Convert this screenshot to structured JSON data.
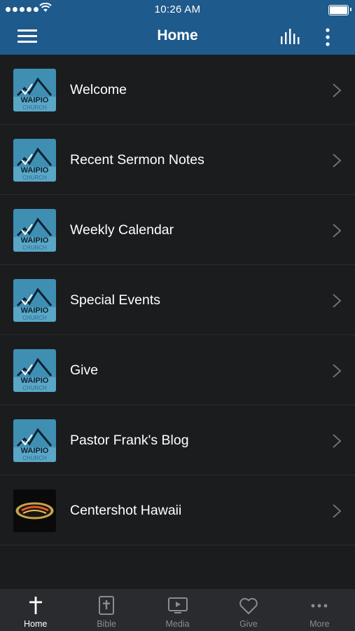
{
  "status_bar": {
    "time": "10:26 AM"
  },
  "nav": {
    "title": "Home"
  },
  "list_items": [
    {
      "label": "Welcome",
      "icon": "waipio-church-logo"
    },
    {
      "label": "Recent Sermon Notes",
      "icon": "waipio-church-logo"
    },
    {
      "label": "Weekly Calendar",
      "icon": "waipio-church-logo"
    },
    {
      "label": "Special Events",
      "icon": "waipio-church-logo"
    },
    {
      "label": "Give",
      "icon": "waipio-church-logo"
    },
    {
      "label": "Pastor Frank's Blog",
      "icon": "waipio-church-logo"
    },
    {
      "label": "Centershot Hawaii",
      "icon": "centershot-logo"
    }
  ],
  "tabs": [
    {
      "label": "Home",
      "icon": "cross-icon",
      "active": true
    },
    {
      "label": "Bible",
      "icon": "bible-icon",
      "active": false
    },
    {
      "label": "Media",
      "icon": "media-icon",
      "active": false
    },
    {
      "label": "Give",
      "icon": "heart-icon",
      "active": false
    },
    {
      "label": "More",
      "icon": "more-icon",
      "active": false
    }
  ],
  "colors": {
    "header": "#1f5a8c",
    "background": "#1b1c1e",
    "tab_bar": "#2a2b2e",
    "tab_inactive": "#8b8c8f",
    "tab_active": "#ffffff"
  }
}
